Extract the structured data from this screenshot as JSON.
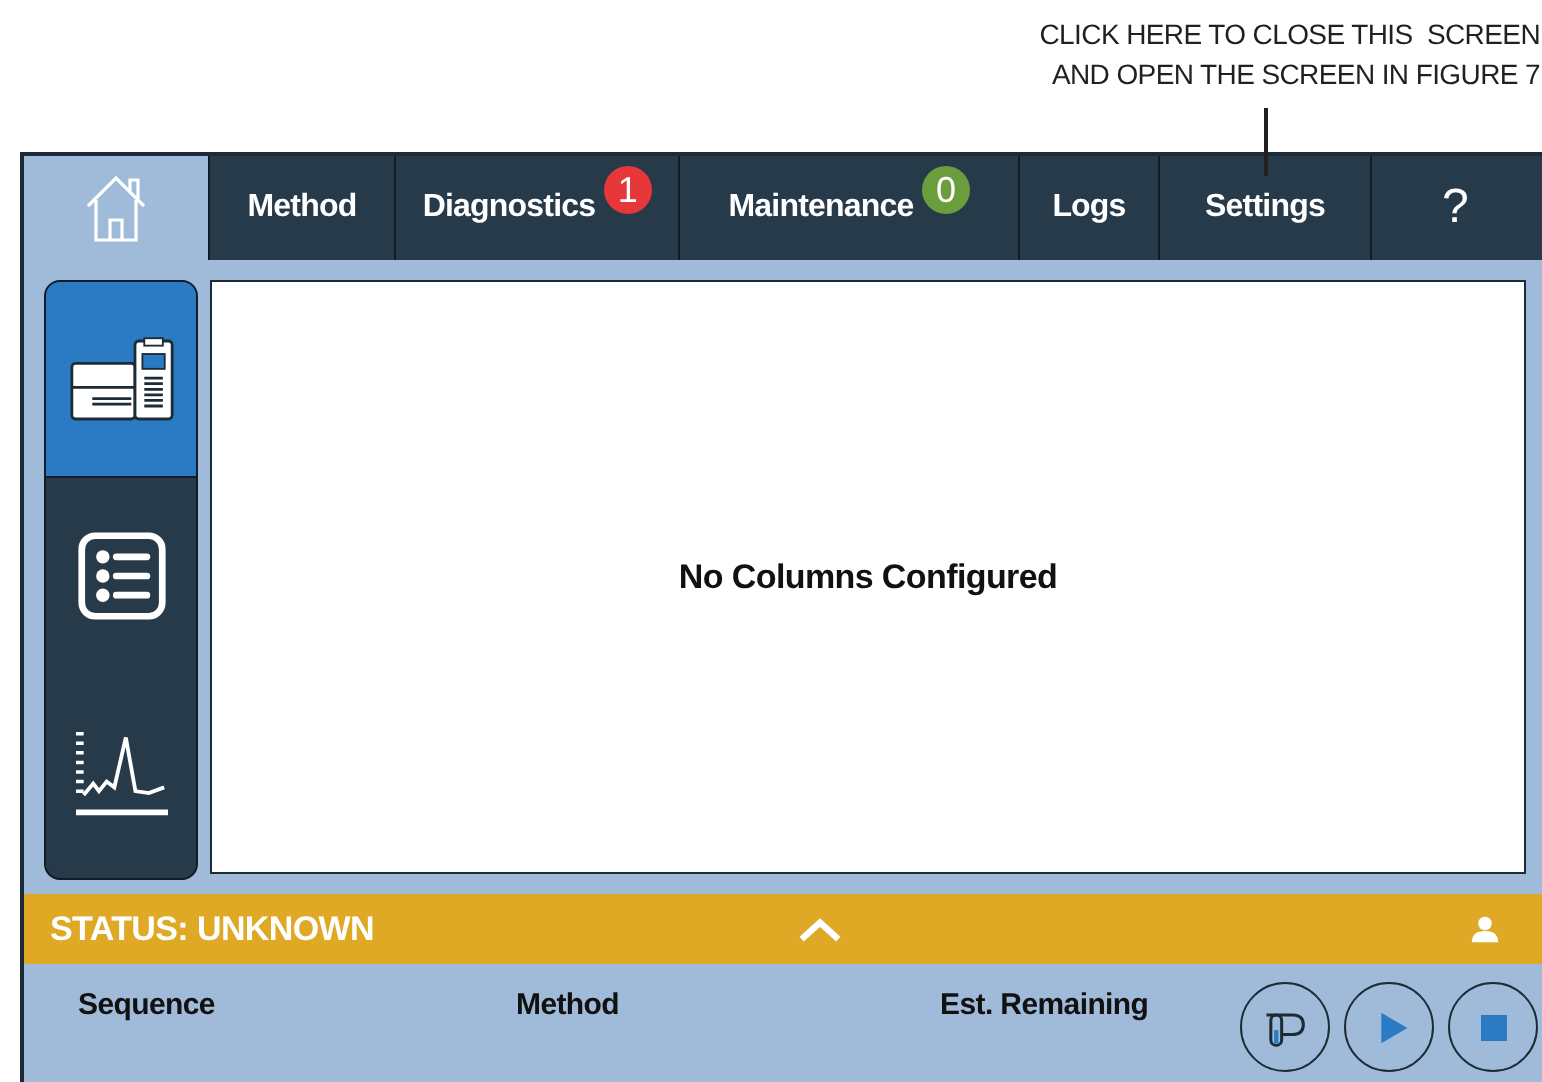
{
  "annotation": {
    "lines": [
      "CLICK HERE TO CLOSE THIS  SCREEN",
      "AND OPEN THE SCREEN IN FIGURE 7"
    ]
  },
  "tabs": [
    {
      "kind": "home",
      "selected": true
    },
    {
      "kind": "text",
      "label": "Method",
      "selected": false
    },
    {
      "kind": "text",
      "label": "Diagnostics",
      "badge": "1",
      "color": "#e8373a",
      "selected": false
    },
    {
      "kind": "text",
      "label": "Maintenance",
      "badge": "0",
      "color": "#6a9e3c",
      "selected": false
    },
    {
      "kind": "text",
      "label": "Logs",
      "selected": false
    },
    {
      "kind": "text",
      "label": "Settings",
      "selected": false
    },
    {
      "kind": "text",
      "label": "?",
      "selected": false
    }
  ],
  "sidebar": {
    "items": [
      {
        "kind": "instrument",
        "selected": true
      },
      {
        "kind": "list",
        "selected": false
      },
      {
        "kind": "chromatogram",
        "selected": false
      }
    ]
  },
  "content": {
    "message": "No Columns Configured"
  },
  "status_bar": {
    "status": "STATUS: UNKNOWN"
  },
  "run_panel": {
    "columns": [
      "Sequence",
      "Method",
      "Est. Remaining"
    ],
    "buttons": [
      {
        "kind": "vial"
      },
      {
        "kind": "play"
      },
      {
        "kind": "stop"
      }
    ]
  }
}
